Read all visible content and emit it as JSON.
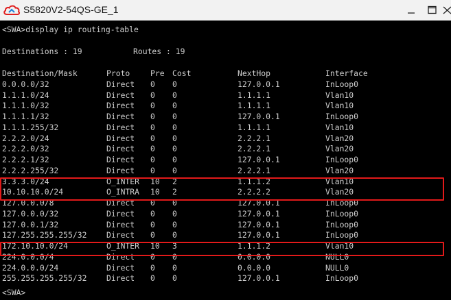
{
  "window": {
    "title": "S5820V2-54QS-GE_1",
    "icon": "cloud-icon"
  },
  "terminal": {
    "command": "<SWA>display ip routing-table",
    "summary_dest_label": "Destinations : 19",
    "summary_routes_label": "Routes : 19",
    "headers": [
      "Destination/Mask",
      "Proto",
      "Pre",
      "Cost",
      "NextHop",
      "Interface"
    ],
    "rows": [
      [
        "0.0.0.0/32",
        "Direct",
        "0",
        "0",
        "127.0.0.1",
        "InLoop0"
      ],
      [
        "1.1.1.0/24",
        "Direct",
        "0",
        "0",
        "1.1.1.1",
        "Vlan10"
      ],
      [
        "1.1.1.0/32",
        "Direct",
        "0",
        "0",
        "1.1.1.1",
        "Vlan10"
      ],
      [
        "1.1.1.1/32",
        "Direct",
        "0",
        "0",
        "127.0.0.1",
        "InLoop0"
      ],
      [
        "1.1.1.255/32",
        "Direct",
        "0",
        "0",
        "1.1.1.1",
        "Vlan10"
      ],
      [
        "2.2.2.0/24",
        "Direct",
        "0",
        "0",
        "2.2.2.1",
        "Vlan20"
      ],
      [
        "2.2.2.0/32",
        "Direct",
        "0",
        "0",
        "2.2.2.1",
        "Vlan20"
      ],
      [
        "2.2.2.1/32",
        "Direct",
        "0",
        "0",
        "127.0.0.1",
        "InLoop0"
      ],
      [
        "2.2.2.255/32",
        "Direct",
        "0",
        "0",
        "2.2.2.1",
        "Vlan20"
      ],
      [
        "3.3.3.0/24",
        "O_INTER",
        "10",
        "2",
        "1.1.1.2",
        "Vlan10"
      ],
      [
        "10.10.10.0/24",
        "O_INTRA",
        "10",
        "2",
        "2.2.2.2",
        "Vlan20"
      ],
      [
        "127.0.0.0/8",
        "Direct",
        "0",
        "0",
        "127.0.0.1",
        "InLoop0"
      ],
      [
        "127.0.0.0/32",
        "Direct",
        "0",
        "0",
        "127.0.0.1",
        "InLoop0"
      ],
      [
        "127.0.0.1/32",
        "Direct",
        "0",
        "0",
        "127.0.0.1",
        "InLoop0"
      ],
      [
        "127.255.255.255/32",
        "Direct",
        "0",
        "0",
        "127.0.0.1",
        "InLoop0"
      ],
      [
        "172.10.10.0/24",
        "O_INTER",
        "10",
        "3",
        "1.1.1.2",
        "Vlan10"
      ],
      [
        "224.0.0.0/4",
        "Direct",
        "0",
        "0",
        "0.0.0.0",
        "NULL0"
      ],
      [
        "224.0.0.0/24",
        "Direct",
        "0",
        "0",
        "0.0.0.0",
        "NULL0"
      ],
      [
        "255.255.255.255/32",
        "Direct",
        "0",
        "0",
        "127.0.0.1",
        "InLoop0"
      ]
    ],
    "prompt": "<SWA>",
    "highlight_color": "#e31a1a",
    "text_color": "#cfcfcf"
  }
}
